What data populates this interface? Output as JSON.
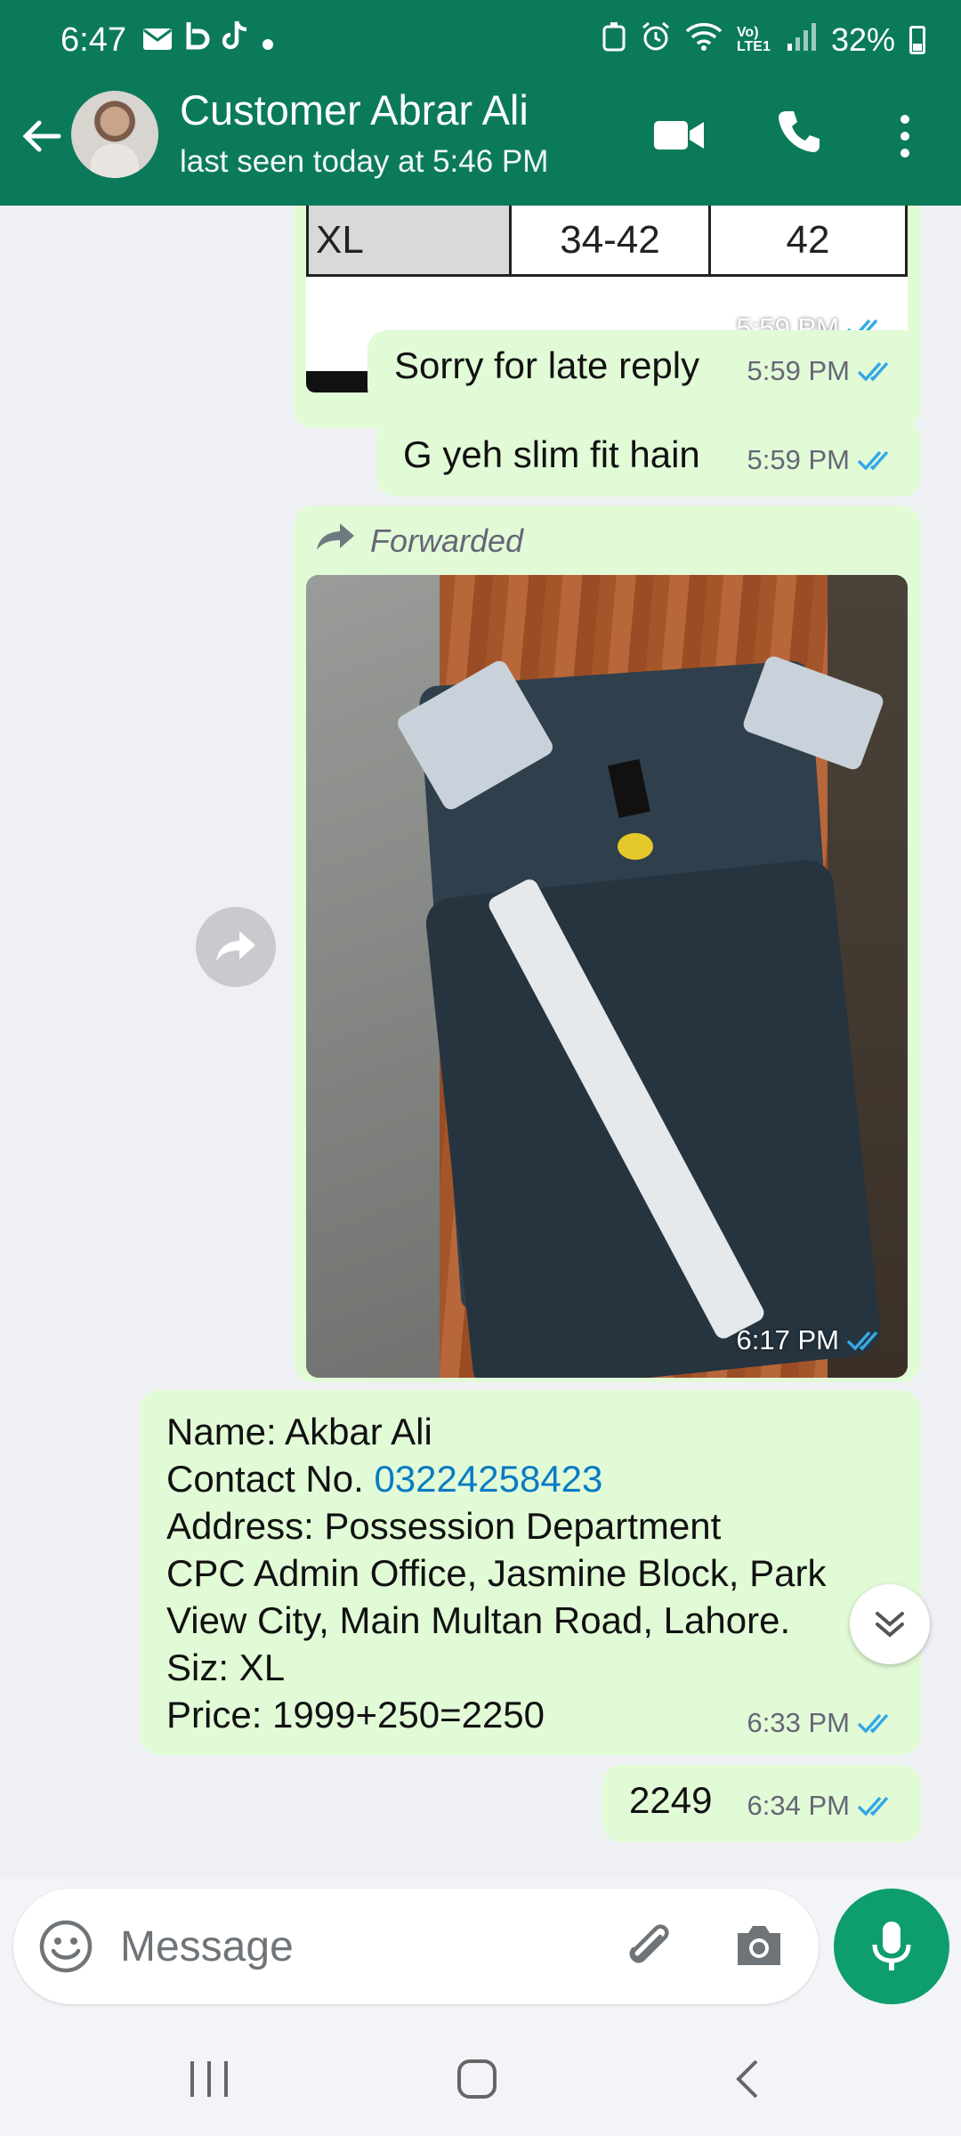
{
  "status_bar": {
    "time": "6:47",
    "network": "Vo) LTE1",
    "battery": "32%"
  },
  "header": {
    "contact_name": "Customer Abrar Ali",
    "last_seen": "last seen today at 5:46 PM"
  },
  "messages": {
    "size_image": {
      "table_row": [
        "XL",
        "34-42",
        "42"
      ],
      "time": "5:59 PM"
    },
    "sorry": {
      "text": "Sorry for late reply",
      "time": "5:59 PM"
    },
    "slim": {
      "text": "G yeh slim fit hain",
      "time": "5:59 PM"
    },
    "forwarded_image": {
      "label": "Forwarded",
      "time": "6:17 PM"
    },
    "address": {
      "line1": "Name: Akbar Ali",
      "line2_label": "Contact No. ",
      "line2_phone": "03224258423",
      "line3": "Address: Possession Department",
      "line4": "CPC Admin Office, Jasmine Block, Park",
      "line5": "View City, Main Multan Road, Lahore.",
      "line6": "Siz: XL",
      "line7": "Price: 1999+250=2250",
      "time": "6:33 PM"
    },
    "amount": {
      "text": "2249",
      "time": "6:34 PM"
    }
  },
  "input": {
    "placeholder": "Message"
  },
  "colors": {
    "header": "#0b7a5b",
    "outgoing_bubble": "#e2fbd7",
    "tick_read": "#34a8e6",
    "mic_button": "#0e9e6e",
    "link": "#0a7bc4"
  }
}
